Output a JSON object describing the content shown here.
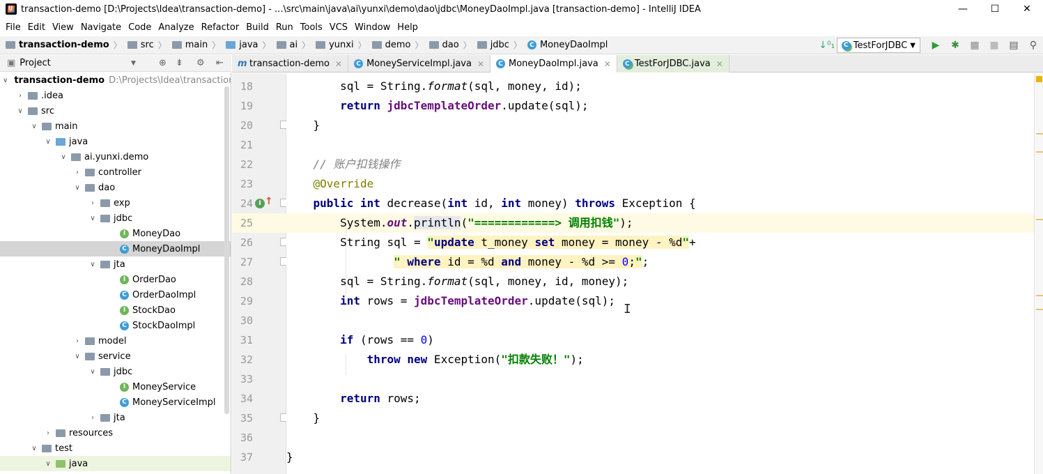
{
  "window": {
    "title": "transaction-demo [D:\\Projects\\Idea\\transaction-demo] - ...\\src\\main\\java\\ai\\yunxi\\demo\\dao\\jdbc\\MoneyDaoImpl.java [transaction-demo] - IntelliJ IDEA",
    "minimize": "—",
    "maximize": "☐",
    "close": "✕"
  },
  "menu": [
    "File",
    "Edit",
    "View",
    "Navigate",
    "Code",
    "Analyze",
    "Refactor",
    "Build",
    "Run",
    "Tools",
    "VCS",
    "Window",
    "Help"
  ],
  "breadcrumbs": [
    "transaction-demo",
    "src",
    "main",
    "java",
    "ai",
    "yunxi",
    "demo",
    "dao",
    "jdbc",
    "MoneyDaoImpl"
  ],
  "toolbar": {
    "run_config": "TestForJDBC",
    "icons": [
      "sort-icon",
      "run-icon",
      "debug-icon",
      "coverage-icon",
      "stop-icon",
      "project-structure-icon",
      "search-icon"
    ]
  },
  "project_panel": {
    "title": "Project",
    "tree": [
      {
        "label": "transaction-demo",
        "path": "D:\\Projects\\Idea\\transaction",
        "depth": 0,
        "expanded": true,
        "type": "module"
      },
      {
        "label": ".idea",
        "depth": 1,
        "expanded": false,
        "type": "folder"
      },
      {
        "label": "src",
        "depth": 1,
        "expanded": true,
        "type": "folder"
      },
      {
        "label": "main",
        "depth": 2,
        "expanded": true,
        "type": "folder"
      },
      {
        "label": "java",
        "depth": 3,
        "expanded": true,
        "type": "src-folder"
      },
      {
        "label": "ai.yunxi.demo",
        "depth": 4,
        "expanded": true,
        "type": "package"
      },
      {
        "label": "controller",
        "depth": 5,
        "expanded": false,
        "type": "package"
      },
      {
        "label": "dao",
        "depth": 5,
        "expanded": true,
        "type": "package"
      },
      {
        "label": "exp",
        "depth": 6,
        "expanded": false,
        "type": "package"
      },
      {
        "label": "jdbc",
        "depth": 6,
        "expanded": true,
        "type": "package"
      },
      {
        "label": "MoneyDao",
        "depth": 7,
        "type": "interface"
      },
      {
        "label": "MoneyDaoImpl",
        "depth": 7,
        "type": "class",
        "selected": true
      },
      {
        "label": "jta",
        "depth": 6,
        "expanded": true,
        "type": "package"
      },
      {
        "label": "OrderDao",
        "depth": 7,
        "type": "interface"
      },
      {
        "label": "OrderDaoImpl",
        "depth": 7,
        "type": "class"
      },
      {
        "label": "StockDao",
        "depth": 7,
        "type": "interface"
      },
      {
        "label": "StockDaoImpl",
        "depth": 7,
        "type": "class"
      },
      {
        "label": "model",
        "depth": 5,
        "expanded": false,
        "type": "package"
      },
      {
        "label": "service",
        "depth": 5,
        "expanded": true,
        "type": "package"
      },
      {
        "label": "jdbc",
        "depth": 6,
        "expanded": true,
        "type": "package"
      },
      {
        "label": "MoneyService",
        "depth": 7,
        "type": "interface"
      },
      {
        "label": "MoneyServiceImpl",
        "depth": 7,
        "type": "class"
      },
      {
        "label": "jta",
        "depth": 6,
        "expanded": false,
        "type": "package"
      },
      {
        "label": "resources",
        "depth": 3,
        "expanded": false,
        "type": "res-folder"
      },
      {
        "label": "test",
        "depth": 2,
        "expanded": true,
        "type": "folder"
      },
      {
        "label": "java",
        "depth": 3,
        "expanded": true,
        "type": "test-folder",
        "highlight": true
      }
    ]
  },
  "tabs": [
    {
      "label": "transaction-demo",
      "icon": "maven-icon",
      "active": false
    },
    {
      "label": "MoneyServiceImpl.java",
      "icon": "class-icon",
      "active": false
    },
    {
      "label": "MoneyDaoImpl.java",
      "icon": "class-icon",
      "active": true
    },
    {
      "label": "TestForJDBC.java",
      "icon": "test-class-icon",
      "active": false
    }
  ],
  "editor": {
    "line_numbers": [
      "18",
      "19",
      "20",
      "21",
      "22",
      "23",
      "24",
      "25",
      "26",
      "27",
      "28",
      "29",
      "30",
      "31",
      "32",
      "33",
      "34",
      "35",
      "36",
      "37"
    ],
    "lines": [
      {
        "text": "        sql = String.format(sql, money, id);"
      },
      {
        "text": "        return jdbcTemplateOrder.update(sql);"
      },
      {
        "text": "    }"
      },
      {
        "text": ""
      },
      {
        "text": "    // 账户扣钱操作"
      },
      {
        "text": "    @Override"
      },
      {
        "text": "    public int decrease(int id, int money) throws Exception {"
      },
      {
        "text": "        System.out.println(\"============> 调用扣钱\");"
      },
      {
        "text": "        String sql = \"update t_money set money = money - %d\"+"
      },
      {
        "text": "                \" where id = %d and money - %d >= 0;\";"
      },
      {
        "text": "        sql = String.format(sql, money, id, money);"
      },
      {
        "text": "        int rows = jdbcTemplateOrder.update(sql);"
      },
      {
        "text": ""
      },
      {
        "text": "        if (rows == 0)"
      },
      {
        "text": "            throw new Exception(\"扣款失败！\");"
      },
      {
        "text": ""
      },
      {
        "text": "        return rows;"
      },
      {
        "text": "    }"
      },
      {
        "text": ""
      },
      {
        "text": "}"
      }
    ],
    "caret_line": "25"
  }
}
